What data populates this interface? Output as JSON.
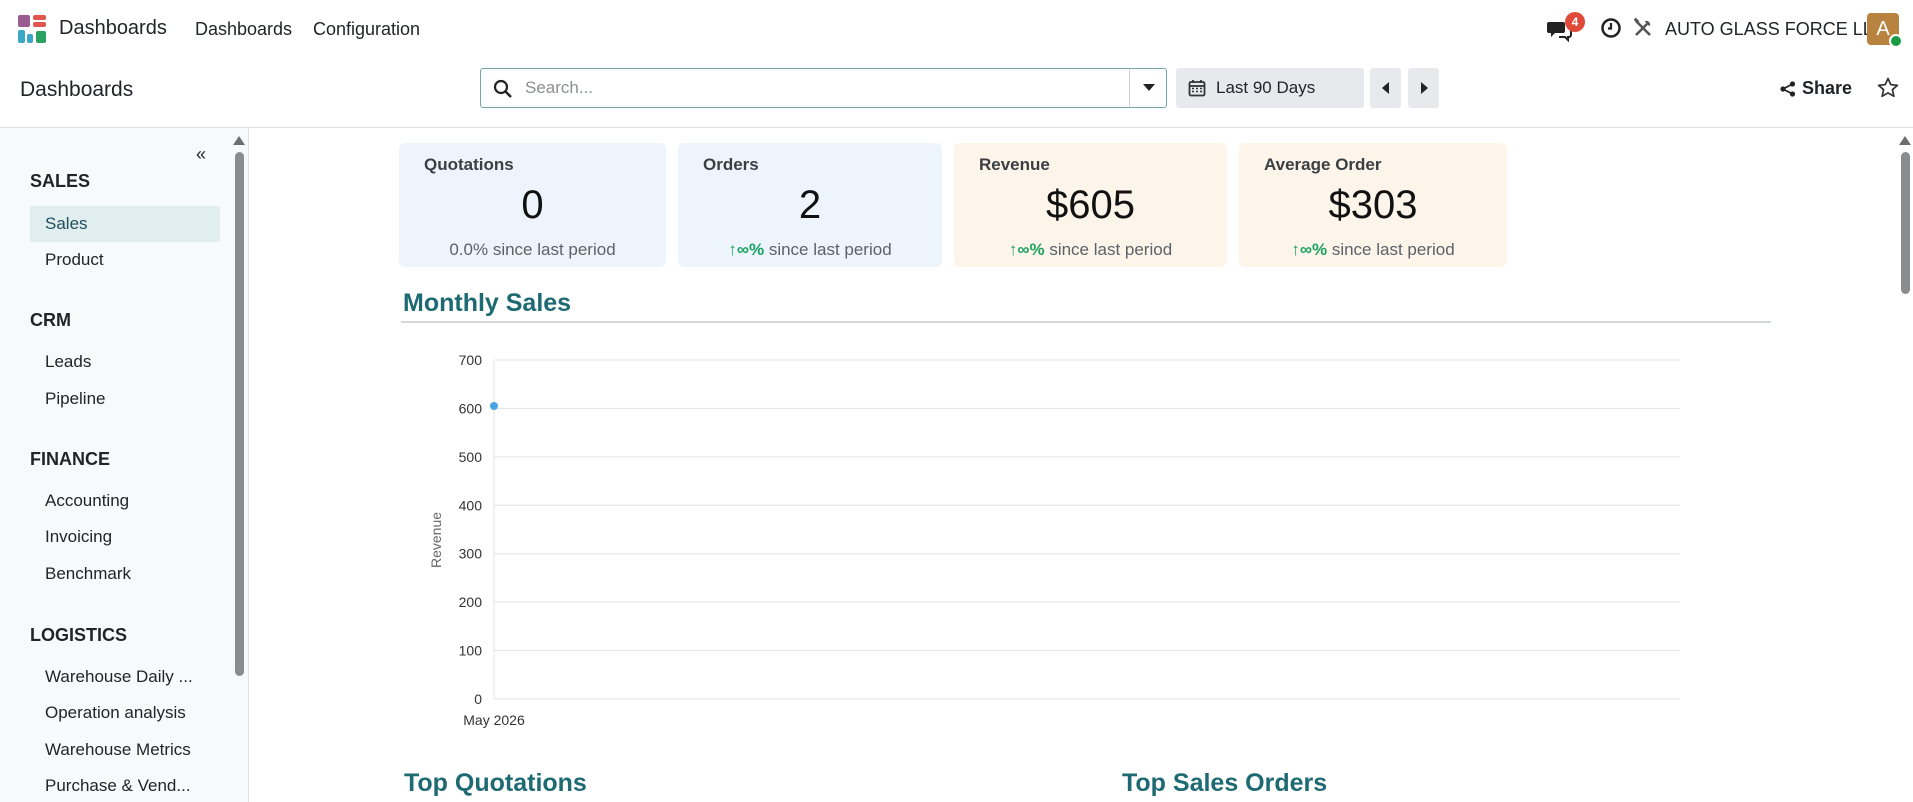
{
  "navbar": {
    "app_name": "Dashboards",
    "menus": [
      "Dashboards",
      "Configuration"
    ],
    "chat_badge": "4",
    "company": "AUTO GLASS FORCE LLC",
    "avatar_letter": "A"
  },
  "control": {
    "breadcrumb": "Dashboards",
    "search_placeholder": "Search...",
    "date_filter": "Last 90 Days",
    "share_label": "Share"
  },
  "sidebar": {
    "sections": [
      {
        "title": "SALES",
        "items": [
          "Sales",
          "Product"
        ]
      },
      {
        "title": "CRM",
        "items": [
          "Leads",
          "Pipeline"
        ]
      },
      {
        "title": "FINANCE",
        "items": [
          "Accounting",
          "Invoicing",
          "Benchmark"
        ]
      },
      {
        "title": "LOGISTICS",
        "items": [
          "Warehouse Daily ...",
          "Operation analysis",
          "Warehouse Metrics",
          "Purchase & Vend..."
        ]
      }
    ],
    "active_item": "Sales"
  },
  "kpis": [
    {
      "title": "Quotations",
      "value": "0",
      "trend": "0.0%",
      "trend_up": false,
      "sub": "since last period",
      "color": "blue"
    },
    {
      "title": "Orders",
      "value": "2",
      "trend": "∞%",
      "trend_up": true,
      "sub": "since last period",
      "color": "blue"
    },
    {
      "title": "Revenue",
      "value": "$605",
      "trend": "∞%",
      "trend_up": true,
      "sub": "since last period",
      "color": "orange"
    },
    {
      "title": "Average Order",
      "value": "$303",
      "trend": "∞%",
      "trend_up": true,
      "sub": "since last period",
      "color": "orange"
    }
  ],
  "sections": {
    "monthly_sales": "Monthly Sales",
    "top_quotations": "Top Quotations",
    "top_sales_orders": "Top Sales Orders"
  },
  "colors": {
    "accent": "#1d6a73",
    "trend_up": "#1aa360",
    "series": "#4aa3df"
  },
  "chart_data": {
    "type": "line",
    "x": [
      "May 2026"
    ],
    "series": [
      {
        "values": [
          605
        ]
      }
    ],
    "ylabel": "Revenue",
    "ylim": [
      0,
      700
    ],
    "yticks": [
      0,
      100,
      200,
      300,
      400,
      500,
      600,
      700
    ],
    "grid": true
  }
}
